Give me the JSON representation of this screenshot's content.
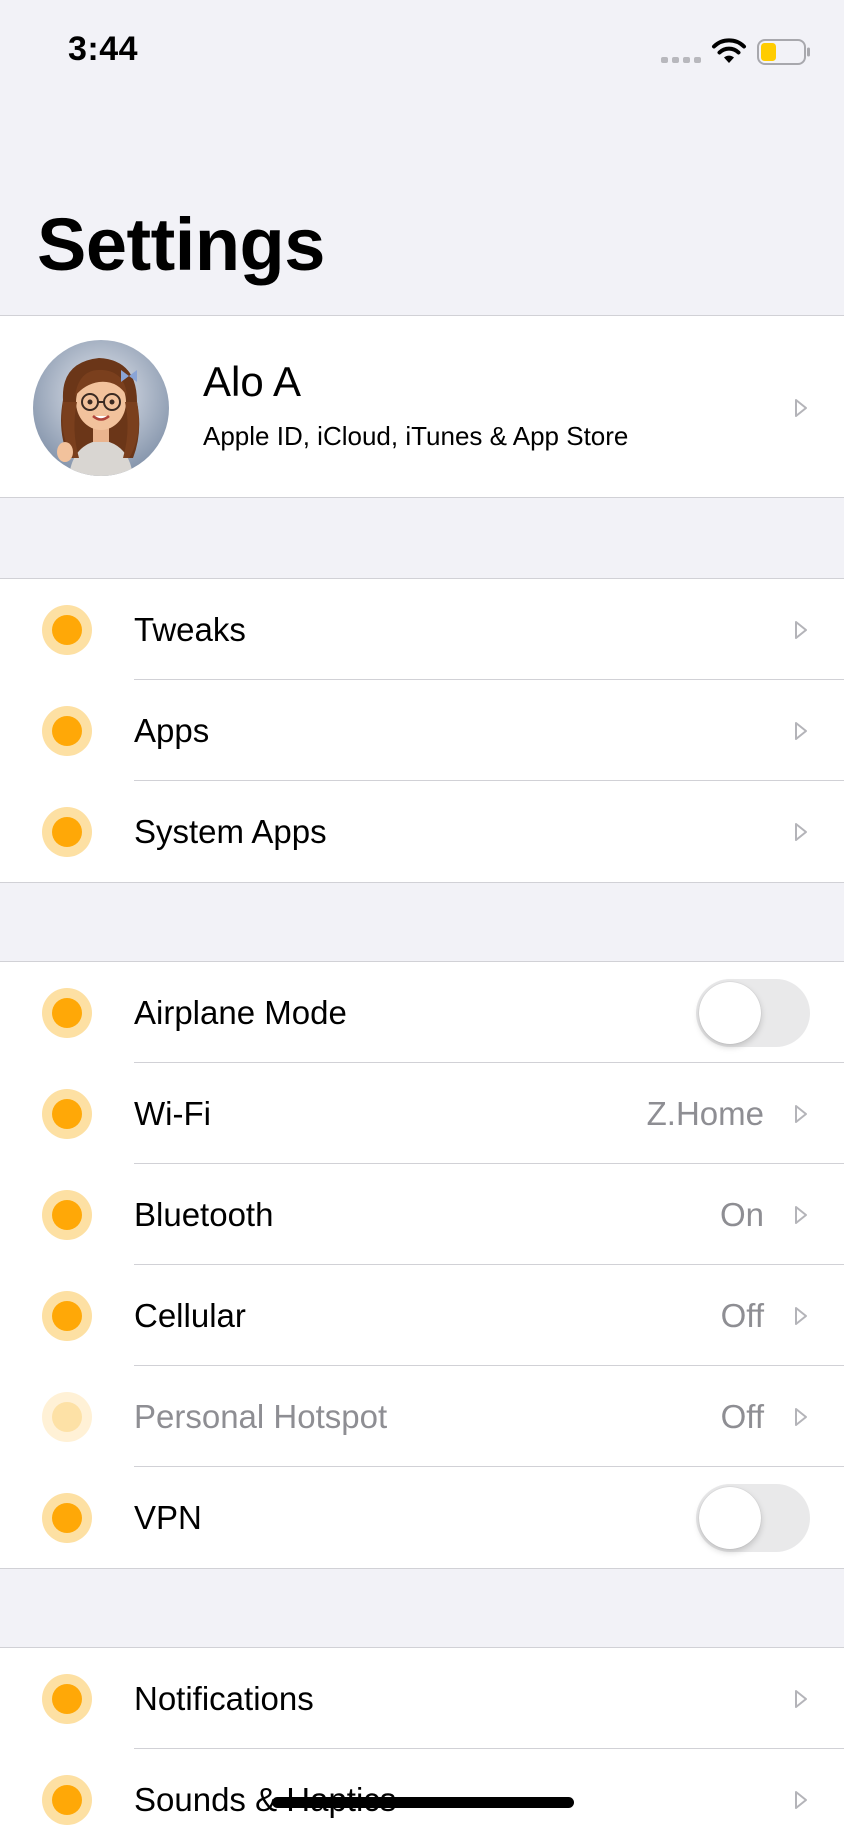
{
  "status_bar": {
    "time": "3:44",
    "icons": [
      "signal-dots-icon",
      "wifi-icon",
      "battery-icon"
    ],
    "battery_color": "#ffcc00"
  },
  "title": "Settings",
  "profile": {
    "name": "Alo A",
    "subtitle": "Apple ID, iCloud, iTunes & App Store"
  },
  "groups": [
    {
      "rows": [
        {
          "label": "Tweaks"
        },
        {
          "label": "Apps"
        },
        {
          "label": "System Apps"
        }
      ]
    },
    {
      "rows": [
        {
          "label": "Airplane Mode",
          "toggle": false
        },
        {
          "label": "Wi-Fi",
          "value": "Z.Home"
        },
        {
          "label": "Bluetooth",
          "value": "On"
        },
        {
          "label": "Cellular",
          "value": "Off"
        },
        {
          "label": "Personal Hotspot",
          "value": "Off",
          "disabled": true
        },
        {
          "label": "VPN",
          "toggle": false
        }
      ]
    },
    {
      "rows": [
        {
          "label": "Notifications"
        },
        {
          "label": "Sounds & Haptics"
        }
      ]
    }
  ],
  "colors": {
    "icon_fill": "#ffa807",
    "icon_ring": "#fde0a3",
    "background": "#f2f2f7",
    "secondary_text": "#8e8e93"
  }
}
